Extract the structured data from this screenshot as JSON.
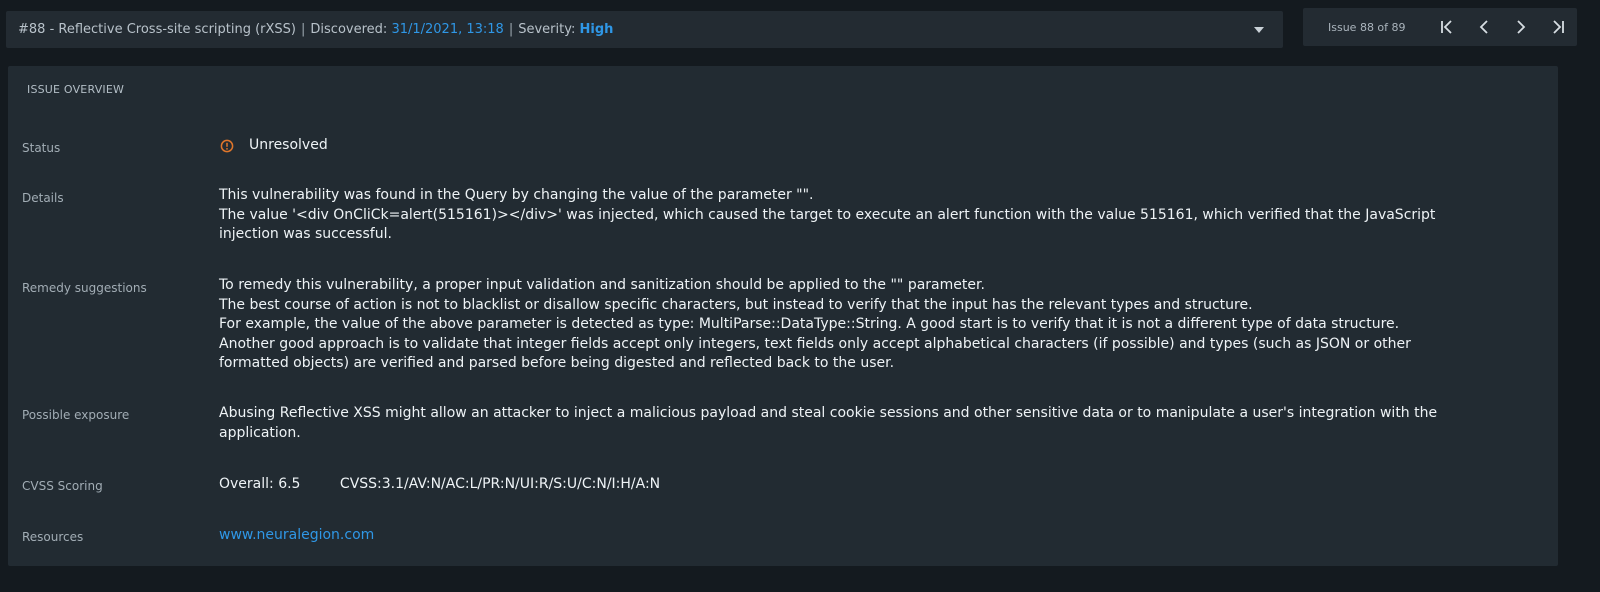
{
  "header": {
    "issue_title": "#88 - Reflective Cross-site scripting (rXSS)",
    "discovered_label": "Discovered:",
    "discovered_value": "31/1/2021, 13:18",
    "severity_label": "Severity:",
    "severity_value": "High",
    "separator": "|",
    "dropdown_icon": "chevron-down-icon"
  },
  "pager": {
    "count_text": "Issue 88 of 89",
    "first_icon": "first-page-icon",
    "prev_icon": "chevron-left-icon",
    "next_icon": "chevron-right-icon",
    "last_icon": "last-page-icon"
  },
  "overview": {
    "title": "ISSUE OVERVIEW",
    "status": {
      "label": "Status",
      "value": "Unresolved",
      "icon": "warning-circle-icon",
      "icon_color": "#e0762b"
    },
    "details": {
      "label": "Details",
      "lines": [
        "This vulnerability was found in the Query by changing the value of the parameter \"\".",
        "The value '<div OnCliCk=alert(515161)></div>' was injected, which caused the target to execute an alert function with the value 515161, which verified that the JavaScript injection was successful."
      ]
    },
    "remedy": {
      "label": "Remedy suggestions",
      "lines": [
        "To remedy this vulnerability, a proper input validation and sanitization should be applied to the \"\" parameter.",
        "The best course of action is not to blacklist or disallow specific characters, but instead to verify that the input has the relevant types and structure.",
        "For example, the value of the above parameter is detected as type: MultiParse::DataType::String. A good start is to verify that it is not a different type of data structure.",
        "Another good approach is to validate that integer fields accept only integers, text fields only accept alphabetical characters (if possible) and types (such as JSON or other formatted objects) are verified and parsed before being digested and reflected back to the user."
      ]
    },
    "exposure": {
      "label": "Possible exposure",
      "text": "Abusing Reflective XSS might allow an attacker to inject a malicious payload and steal cookie sessions and other sensitive data or to manipulate a user's integration with the application."
    },
    "cvss": {
      "label": "CVSS Scoring",
      "overall": "Overall: 6.5",
      "vector": "CVSS:3.1/AV:N/AC:L/PR:N/UI:R/S:U/C:N/I:H/A:N"
    },
    "resources": {
      "label": "Resources",
      "link_text": "www.neuralegion.com"
    }
  },
  "colors": {
    "background": "#141a1f",
    "panel": "#222b32",
    "accent": "#2f97e6",
    "warning": "#e0762b"
  }
}
